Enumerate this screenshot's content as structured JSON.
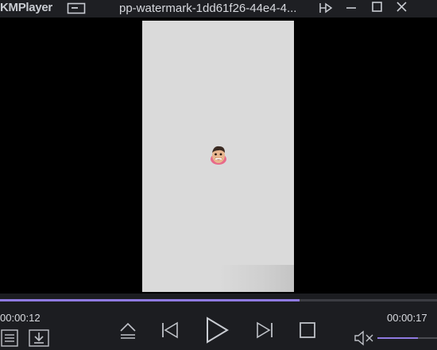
{
  "window": {
    "app_name": "KMPlayer",
    "file_title": "pp-watermark-1dd61f26-44e4-4..."
  },
  "playback": {
    "current_time": "00:00:12",
    "total_time": "00:00:17",
    "progress_fraction": 0.6857,
    "volume_fraction": 0.68
  },
  "colors": {
    "accent": "#8f7ae0",
    "titlebar": "#1e1f23",
    "controlbar": "#1c1d21",
    "video_frame": "#dadada"
  },
  "icons": {
    "titlebar": [
      "mini-mode-icon",
      "pin-icon",
      "minimize-icon",
      "maximize-icon",
      "close-icon"
    ],
    "controls": [
      "playlist-icon",
      "download-icon",
      "eject-icon",
      "previous-icon",
      "play-icon",
      "next-icon",
      "stop-icon",
      "mute-icon"
    ]
  }
}
